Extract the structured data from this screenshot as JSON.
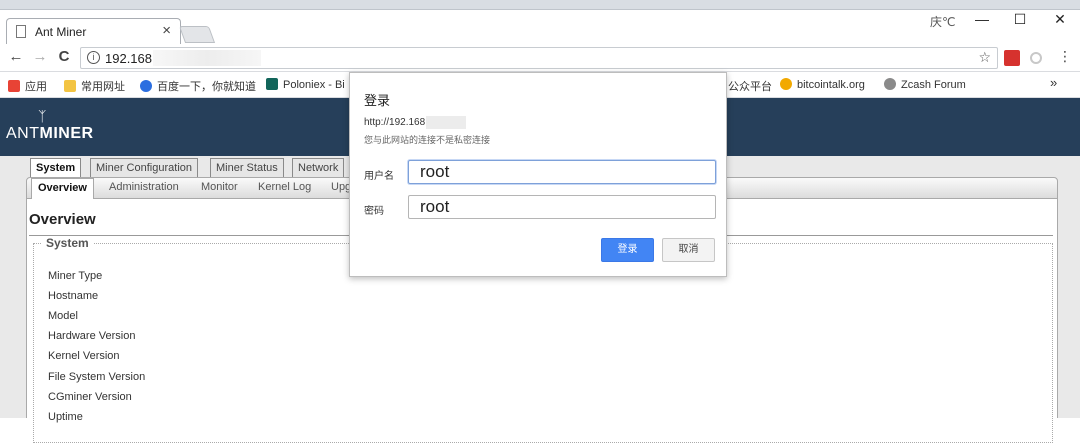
{
  "browser": {
    "tab": {
      "title": "Ant Miner",
      "close": "×"
    },
    "window_controls": {
      "minimize": "—",
      "maximize": "☐",
      "close": "✕"
    },
    "profile_label": "庆℃",
    "nav": {
      "back": "←",
      "forward": "→",
      "reload": "C"
    },
    "address": {
      "info": "i",
      "url": "192.168."
    },
    "star": "☆",
    "bookmarks": [
      {
        "label": "应用",
        "color": "#e84335",
        "icon": "apps-icon"
      },
      {
        "label": "常用网址",
        "color": "#f3c442",
        "icon": "folder-icon"
      },
      {
        "label": "百度一下，你就知道",
        "color": "#2b6ee0",
        "icon": "baidu-icon"
      },
      {
        "label": "Poloniex - Bi",
        "color": "#12655a",
        "icon": "poloniex-icon"
      },
      {
        "label": "公众平台",
        "color": "",
        "icon": ""
      },
      {
        "label": "bitcointalk.org",
        "color": "#f2a900",
        "icon": "bitcoin-icon"
      },
      {
        "label": "Zcash Forum",
        "color": "#8a8a8a",
        "icon": "zcash-icon"
      }
    ],
    "bookmarks_more": "»"
  },
  "page": {
    "logo_prefix": "ANT",
    "logo_suffix": "MINER",
    "main_tabs": [
      "System",
      "Miner Configuration",
      "Miner Status",
      "Network"
    ],
    "sub_tabs": [
      "Overview",
      "Administration",
      "Monitor",
      "Kernel Log",
      "Upg"
    ],
    "title": "Overview",
    "section": "System",
    "fields": [
      "Miner Type",
      "Hostname",
      "Model",
      "Hardware Version",
      "Kernel Version",
      "File System Version",
      "CGminer Version",
      "Uptime"
    ]
  },
  "dialog": {
    "title": "登录",
    "url": "http://192.168.",
    "note": "您与此网站的连接不是私密连接",
    "username_label": "用户名",
    "username_value": "root",
    "password_label": "密码",
    "password_value": "root",
    "login_button": "登录",
    "cancel_button": "取消"
  },
  "colors": {
    "accent": "#4285f4",
    "header": "#263f5a"
  }
}
